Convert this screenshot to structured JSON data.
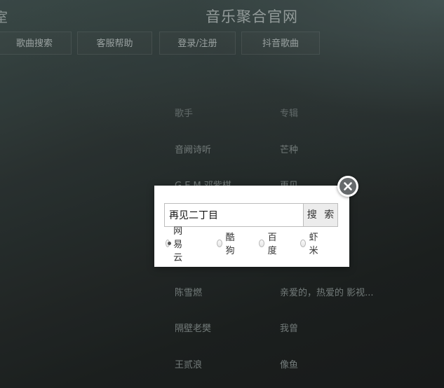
{
  "header": {
    "title": "音乐聚合官网",
    "brand_fragment": "室"
  },
  "nav": {
    "items": [
      {
        "label": "歌曲搜索"
      },
      {
        "label": "客服帮助"
      },
      {
        "label": "登录/注册"
      },
      {
        "label": "抖音歌曲"
      }
    ]
  },
  "list": {
    "header": {
      "artist": "歌手",
      "album": "专辑"
    },
    "rows": [
      {
        "artist": "音阙诗听",
        "album": "芒种"
      },
      {
        "artist": "G.E.M.邓紫棋",
        "album": "再见"
      },
      {
        "artist": "陈雪燃",
        "album": "亲爱的，热爱的 影视..."
      },
      {
        "artist": "隔壁老樊",
        "album": "我曾"
      },
      {
        "artist": "王贰浪",
        "album": "像鱼"
      }
    ]
  },
  "dialog": {
    "query_value": "再见二丁目",
    "search_label": "搜 索",
    "close_icon": "close-icon",
    "sources": [
      {
        "label": "网易云",
        "checked": true
      },
      {
        "label": "酷狗",
        "checked": false
      },
      {
        "label": "百度",
        "checked": false
      },
      {
        "label": "虾米",
        "checked": false
      }
    ]
  }
}
